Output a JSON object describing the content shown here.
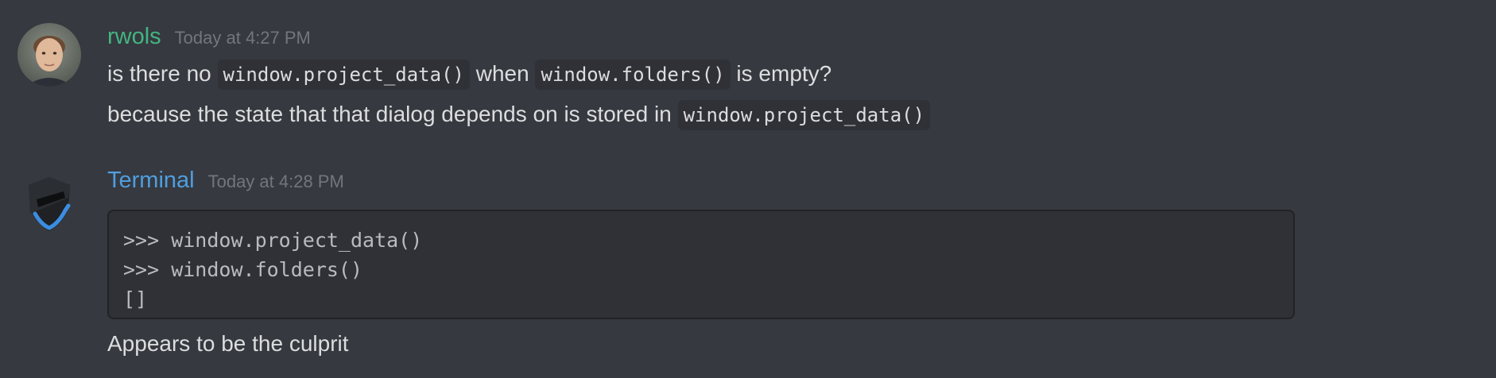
{
  "messages": [
    {
      "author": "rwols",
      "author_color": "#43b581",
      "timestamp": "Today at 4:27 PM",
      "lines": [
        {
          "segments": [
            {
              "type": "text",
              "text": "is there no "
            },
            {
              "type": "code",
              "text": "window.project_data()"
            },
            {
              "type": "text",
              "text": " when "
            },
            {
              "type": "code",
              "text": "window.folders()"
            },
            {
              "type": "text",
              "text": " is empty?"
            }
          ]
        },
        {
          "segments": [
            {
              "type": "text",
              "text": "because the state that that dialog depends on is stored in "
            },
            {
              "type": "code",
              "text": "window.project_data()"
            }
          ]
        }
      ]
    },
    {
      "author": "Terminal",
      "author_color": "#4f9ee0",
      "timestamp": "Today at 4:28 PM",
      "code_block": [
        ">>> window.project_data()",
        ">>> window.folders()",
        "[]"
      ],
      "text_after": "Appears to be the culprit"
    }
  ]
}
